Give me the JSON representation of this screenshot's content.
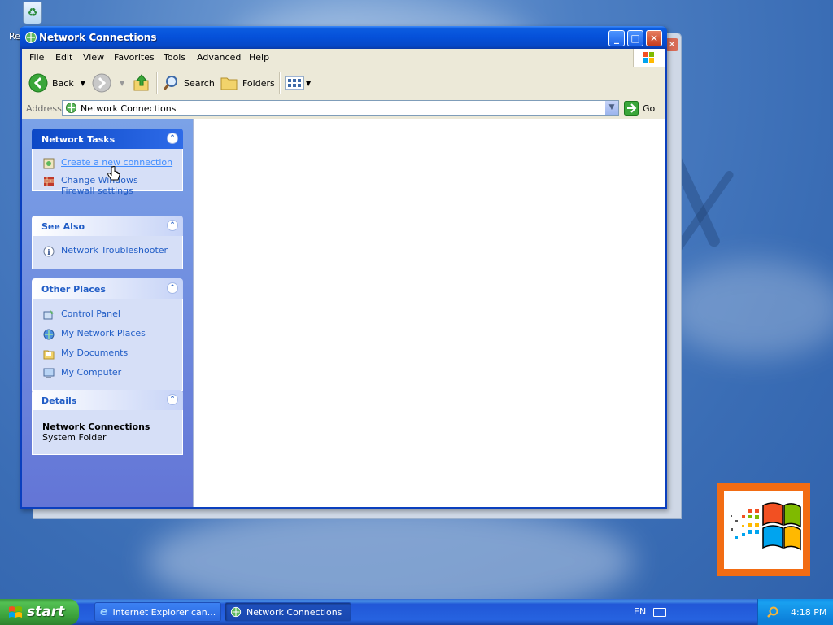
{
  "desktop": {
    "recycle_label": "Re"
  },
  "window": {
    "title": "Network Connections",
    "buttons": {
      "minimize": "_",
      "maximize": "□",
      "close": "✕"
    }
  },
  "menu": [
    "File",
    "Edit",
    "View",
    "Favorites",
    "Tools",
    "Advanced",
    "Help"
  ],
  "toolbar": {
    "back": "Back",
    "search": "Search",
    "folders": "Folders"
  },
  "address": {
    "label": "Address",
    "value": "Network Connections",
    "go": "Go"
  },
  "panels": {
    "network_tasks": {
      "title": "Network Tasks",
      "items": [
        "Create a new connection",
        "Change Windows Firewall settings"
      ]
    },
    "see_also": {
      "title": "See Also",
      "items": [
        "Network Troubleshooter"
      ]
    },
    "other_places": {
      "title": "Other Places",
      "items": [
        "Control Panel",
        "My Network Places",
        "My Documents",
        "My Computer"
      ]
    },
    "details": {
      "title": "Details",
      "name": "Network Connections",
      "type": "System Folder"
    }
  },
  "taskbar": {
    "start": "start",
    "tasks": [
      "Internet Explorer can...",
      "Network Connections"
    ],
    "language": "EN",
    "clock": "4:18 PM"
  },
  "colors": {
    "title_blue": "#0550d9",
    "link_blue": "#215dc6",
    "start_green": "#3a9f3a",
    "logo_orange": "#f26c13"
  }
}
